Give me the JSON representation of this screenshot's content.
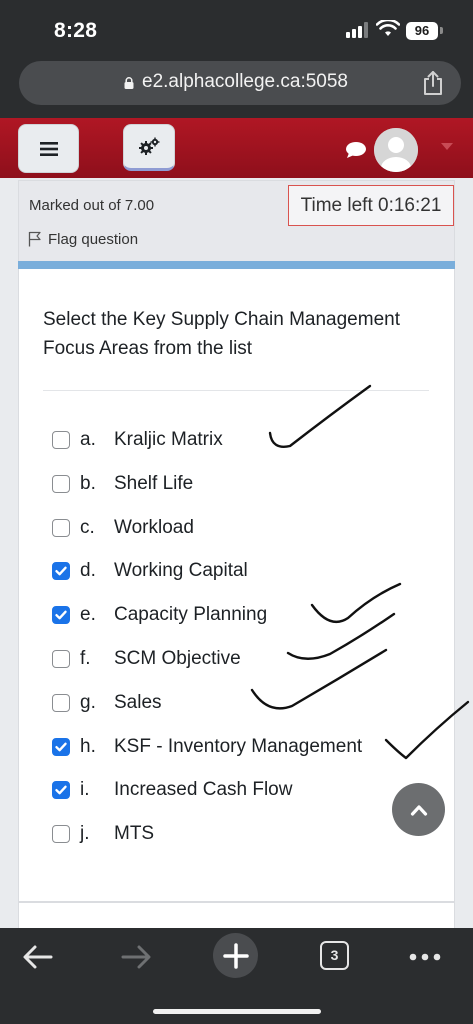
{
  "status_bar": {
    "time": "8:28",
    "battery": "96",
    "icons": [
      "signal-icon",
      "wifi-icon",
      "battery-icon"
    ]
  },
  "browser": {
    "url": "e2.alphacollege.ca:5058",
    "icons": [
      "lock-icon",
      "share-icon"
    ]
  },
  "header": {
    "icons": [
      "hamburger-icon",
      "gear-icon",
      "chat-bubble-icon",
      "user-avatar",
      "caret-down-icon"
    ]
  },
  "question": {
    "marked_out_of": "Marked out of 7.00",
    "flag_label": "Flag question",
    "time_left": "Time left 0:16:21",
    "text": "Select the Key Supply Chain Management Focus Areas from the list",
    "options": [
      {
        "letter": "a.",
        "label": "Kraljic Matrix",
        "checked": false
      },
      {
        "letter": "b.",
        "label": "Shelf Life",
        "checked": false
      },
      {
        "letter": "c.",
        "label": "Workload",
        "checked": false
      },
      {
        "letter": "d.",
        "label": "Working Capital",
        "checked": true
      },
      {
        "letter": "e.",
        "label": "Capacity Planning",
        "checked": true
      },
      {
        "letter": "f.",
        "label": "SCM Objective",
        "checked": false
      },
      {
        "letter": "g.",
        "label": "Sales",
        "checked": false
      },
      {
        "letter": "h.",
        "label": "KSF - Inventory Management",
        "checked": true
      },
      {
        "letter": "i.",
        "label": "Increased Cash Flow",
        "checked": true
      },
      {
        "letter": "j.",
        "label": "MTS",
        "checked": false
      }
    ]
  },
  "bottom_bar": {
    "tab_count": "3",
    "icons": [
      "back-arrow-icon",
      "forward-arrow-icon",
      "new-tab-plus-icon",
      "tabs-icon",
      "more-dots-icon"
    ]
  },
  "colors": {
    "header_red": "#a3121f",
    "checkbox_blue": "#1a73e8",
    "timer_border": "#d9534f",
    "strip_blue": "#7aaedb"
  }
}
